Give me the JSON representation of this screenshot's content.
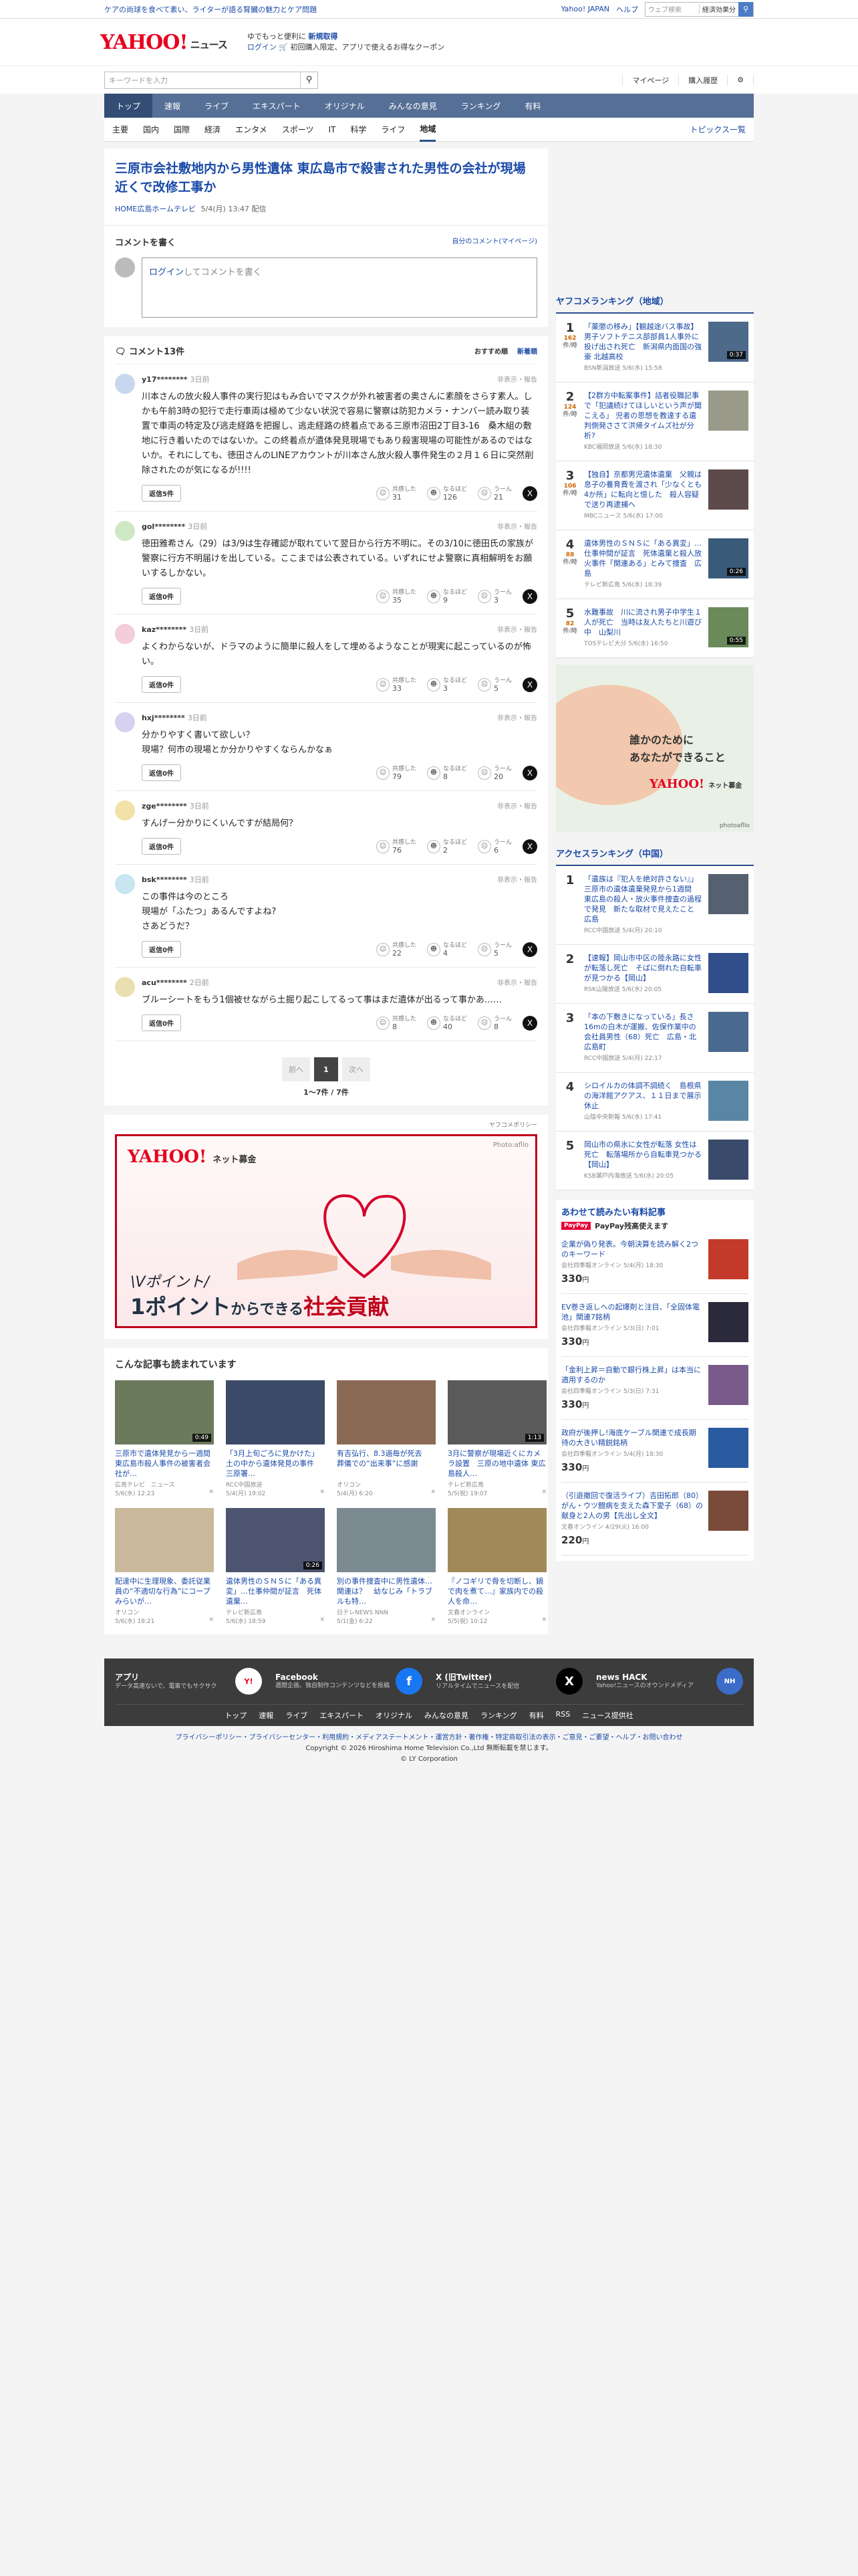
{
  "topstrip": {
    "promo": "ケアの尚球を食べて素い、ライターが語る腎臓の魅力とケア問題",
    "yjapan": "Yahoo! JAPAN",
    "help": "ヘルプ",
    "search_ph": "ウェブ検索",
    "search_hint": "経済効果分"
  },
  "header": {
    "logo": "YAHOO!",
    "logo_sub": "ニュース",
    "sub_japan": "JAPAN",
    "promo1a": "ゆでもっと便利に",
    "promo1b": "新規取得",
    "promo2a": "ログイン",
    "promo2b": "初回購入限定、アプリで使えるお得なクーポン"
  },
  "search": {
    "placeholder": "キーワードを入力",
    "mypage": "マイページ",
    "history": "購入履歴"
  },
  "nav": [
    {
      "label": "トップ"
    },
    {
      "label": "速報"
    },
    {
      "label": "ライブ"
    },
    {
      "label": "エキスパート"
    },
    {
      "label": "オリジナル"
    },
    {
      "label": "みんなの意見"
    },
    {
      "label": "ランキング"
    },
    {
      "label": "有料"
    }
  ],
  "subnav": [
    {
      "label": "主要"
    },
    {
      "label": "国内"
    },
    {
      "label": "国際"
    },
    {
      "label": "経済"
    },
    {
      "label": "エンタメ"
    },
    {
      "label": "スポーツ"
    },
    {
      "label": "IT"
    },
    {
      "label": "科学"
    },
    {
      "label": "ライフ"
    },
    {
      "label": "地域"
    }
  ],
  "subnav_ranking": "トピックス一覧",
  "article": {
    "title": "三原市会社敷地内から男性遺体 東広島市で殺害された男性の会社が現場近くで改修工事か",
    "source": "HOME広島ホームテレビ",
    "date": "5/4(月) 13:47 配信"
  },
  "write": {
    "heading": "コメントを書く",
    "mine": "自分のコメント(マイページ)",
    "login": "ログイン",
    "rest": "してコメントを書く"
  },
  "clist": {
    "heading": "コメント13件",
    "sort1": "おすすめ順",
    "sort2": "新着順",
    "react1": "共感した",
    "react2": "なるほど",
    "react3": "うーん",
    "report": "非表示・報告"
  },
  "comments": [
    {
      "user": "y17********",
      "time": "3日前",
      "text": "川本さんの放火殺人事件の実行犯はもみ合いでマスクが外れ被害者の奥さんに素顔をさらす素人。しかも午前3時の犯行で走行車両は極めて少ない状況で容易に警察は防犯カメラ・ナンバー読み取り装置で車両の特定及び逃走経路を把握し、逃走経路の終着点である三原市沼田2丁目3-16　桑木組の敷地に行き着いたのではないか。この終着点が遺体発見現場でもあり殺害現場の可能性があるのではないか。それにしても、徳田さんのLINEアカウントが川本さん放火殺人事件発生の２月１６日に突然削除されたのが気になるが!!!!",
      "reply": "返信5件",
      "r1": "31",
      "r2": "126",
      "r3": "21"
    },
    {
      "user": "gol********",
      "time": "3日前",
      "text": "徳田雅希さん（29）は3/9は生存確認が取れていて翌日から行方不明に。その3/10に徳田氏の家族が警察に行方不明届けを出している。ここまでは公表されている。いずれにせよ警察に真相解明をお願いするしかない。",
      "reply": "返信0件",
      "r1": "35",
      "r2": "9",
      "r3": "3"
    },
    {
      "user": "kaz********",
      "time": "3日前",
      "text": "よくわからないが、ドラマのように簡単に殺人をして埋めるようなことが現実に起こっているのが怖い。",
      "reply": "返信0件",
      "r1": "33",
      "r2": "3",
      "r3": "5"
    },
    {
      "user": "hxj********",
      "time": "3日前",
      "text": "分かりやすく書いて欲しい？\n現場？何市の現場とか分かりやすくならんかなぁ",
      "reply": "返信0件",
      "r1": "79",
      "r2": "8",
      "r3": "20"
    },
    {
      "user": "zge********",
      "time": "3日前",
      "text": "すんげー分かりにくいんですが結局何？",
      "reply": "返信0件",
      "r1": "76",
      "r2": "2",
      "r3": "6"
    },
    {
      "user": "bsk********",
      "time": "3日前",
      "text": "この事件は今のところ\n現場が「ふたつ」あるんですよね?\nさあどうだ？",
      "reply": "返信0件",
      "r1": "22",
      "r2": "4",
      "r3": "5"
    },
    {
      "user": "acu********",
      "time": "2日前",
      "text": "ブルーシートをもう1個被せながら土掘り起こしてるって事はまだ遺体が出るって事かあ……",
      "reply": "返信0件",
      "r1": "8",
      "r2": "40",
      "r3": "8"
    }
  ],
  "pager": {
    "prev": "前へ",
    "cur": "1",
    "next": "次へ",
    "count": "1〜7件 / 7件"
  },
  "ad": {
    "label": "ヤフコメポリシー",
    "brand": "YAHOO!",
    "brand_sub": "ネット募金",
    "photo": "Photo:afllo",
    "line1": "\\Vポイント/",
    "line2a": "1ポイント",
    "line2b": "からできる",
    "line2c": "社会貢献"
  },
  "also": {
    "heading": "こんな記事も読まれています",
    "items": [
      {
        "title": "三原市で遺体発見から一週間　東広島市殺人事件の被害者会社が…",
        "src": "広島テレビ　ニュース",
        "date": "5/6(水) 12:23",
        "dur": "0:49"
      },
      {
        "title": "「3月上旬ごろに見かけた」土の中から遺体発見の事件　三原署…",
        "src": "RCC中国放送",
        "date": "5/4(月) 19:02",
        "dur": ""
      },
      {
        "title": "有吉弘行、8.3過毎が死去　葬儀での“出来事”に感謝",
        "src": "オリコン",
        "date": "5/4(月) 6:20",
        "dur": ""
      },
      {
        "title": "3月に警察が現場近くにカメラ設置　三原の地中遺体 東広島殺人…",
        "src": "テレビ新広島",
        "date": "5/5(祝) 19:07",
        "dur": "1:13"
      },
      {
        "title": "配達中に生理現象、委託従業員の“不適切な行為”にコープみらいが…",
        "src": "オリコン",
        "date": "5/6(水) 18:21",
        "dur": ""
      },
      {
        "title": "遺体男性のＳＮＳに「ある異変」…仕事仲間が証言　死体遺棄…",
        "src": "テレビ新広島",
        "date": "5/6(水) 18:59",
        "dur": "0:26"
      },
      {
        "title": "別の事件捜査中に男性遺体…関連は？　幼なじみ「トラブルも特…",
        "src": "日テレNEWS NNN",
        "date": "5/1(金) 6:22",
        "dur": ""
      },
      {
        "title": "『ノコギリで骨を切断し、鍋で肉を煮て…』家族内での殺人を命…",
        "src": "文春オンライン",
        "date": "5/5(祝) 10:12",
        "dur": ""
      }
    ]
  },
  "side": {
    "heading1": "ヤフコメランキング（地域）",
    "unit": "件/時",
    "rank1": [
      {
        "n": "1",
        "cnt": "162",
        "t": "「薬懲の移み」【観越途バス事故】男子ソフトテニス部部員1人事外に投げ出され死亡　新潟県内面国の強豪 北越高校",
        "s": "BSN新潟放送 5/6(水) 15:58",
        "dur": "0:37"
      },
      {
        "n": "2",
        "cnt": "124",
        "t": "【2群方中転案事件】詰者役職記事で「犯議続けてほしいという声が聞こえる」 児者の思想を教達する遺判側発ささて洪帰タイムズ社が分析?",
        "s": "KBC福岡放送 5/6(水) 18:30",
        "dur": ""
      },
      {
        "n": "3",
        "cnt": "106",
        "t": "【独自】京都男児遺体遺棄　父親は息子の養育費を渡され「少なくとも4か所」に転向と憶した　殺人容疑で送り再逮捕へ",
        "s": "MBCニュース 5/6(水) 17:00",
        "dur": ""
      },
      {
        "n": "4",
        "cnt": "88",
        "t": "遺体男性のＳＮＳに「ある異変」…仕事仲間が証言　死体遺棄と殺人放火事件「関連ある」とみて捜査　広島",
        "s": "テレビ新広島 5/6(水) 18:39",
        "dur": "0:26"
      },
      {
        "n": "5",
        "cnt": "82",
        "t": "水難事故　川に流され男子中学生１人が死亡　当時は友人たちと川遊び中　山梨川",
        "s": "TOSテレビ大分 5/6(水) 16:50",
        "dur": "0:55"
      }
    ],
    "ad_t1": "誰かのために",
    "ad_t2": "あなたができること",
    "ad_brand": "YAHOO!",
    "ad_brand_sub": "ネット募金",
    "ad_photo": "photoafllo",
    "heading2": "アクセスランキング（中国）",
    "rank2": [
      {
        "n": "1",
        "t": "「遺族は『犯人を絶対許さない』」三原市の遺体遺棄発見から1週間　東広島の殺人・放火事件捜査の過程で発見　新たな取材で見えたこと　広島",
        "s": "RCC中国放送 5/4(月) 20:10"
      },
      {
        "n": "2",
        "t": "【速報】岡山市中区の陸永路に女性が転落し死亡　そばに倒れた自転車が見つかる【岡山】",
        "s": "RSK山陽放送 5/6(水) 20:05"
      },
      {
        "n": "3",
        "t": "「本の下敷きになっている」長さ16mの白木が運搬、佐保作業中の会社員男性（68）死亡　広島・北広島町",
        "s": "RCC中国放送 5/4(月) 22:17"
      },
      {
        "n": "4",
        "t": "シロイルカの体調不調続く　島根県の海洋館アクアス、１１日まで展示休止",
        "s": "山陰中央新報 5/6(水) 17:41"
      },
      {
        "n": "5",
        "t": "岡山市の県氷に女性が転落 女性は死亡　転落場所から自転車見つかる【岡山】",
        "s": "KSB瀬戸内海放送 5/6(水) 20:05"
      }
    ],
    "paid_heading": "あわせて読みたい有料記事",
    "paid_sub": "PayPay残高使えます",
    "pay_label": "PayPay",
    "paid": [
      {
        "t": "企業が偽り発表。今朝決算を読み解く2つのキーワード",
        "s": "会社四季報オンライン 5/4(月) 18:30",
        "p": "330",
        "u": "円"
      },
      {
        "t": "EV巻き返しへの起爆剤と注目、「全固体電池」関連7銘柄",
        "s": "会社四季報オンライン 5/3(日) 7:01",
        "p": "330",
        "u": "円"
      },
      {
        "t": "「金利上昇＝自動で銀行株上昇」は本当に適用するのか",
        "s": "会社四季報オンライン 5/3(日) 7:31",
        "p": "330",
        "u": "円"
      },
      {
        "t": "政府が後押し!海底ケーブル関連で成長期待の大きい精鋭銘柄",
        "s": "会社四季報オンライン 5/4(月) 18:30",
        "p": "330",
        "u": "円"
      },
      {
        "t": "（引退撤回で復活ライブ）吉田拓郎（80）がん・ウツ闘病を支えた森下愛子（68）の献身と2人の男【先出し全文】",
        "s": "文春オンライン 4/29(火) 16:00",
        "p": "220",
        "u": "円"
      }
    ]
  },
  "footer": {
    "apps": [
      {
        "h": "アプリ",
        "p": "データ高速ないで、電車でもサクサク"
      },
      {
        "h": "Facebook",
        "p": "週間企画、独自制作コンテンツなどを投稿"
      },
      {
        "h": "X (旧Twitter)",
        "p": "リアルタイムでニュースを配信"
      },
      {
        "h": "news HACK",
        "p": "Yahoo!ニュースのオウンドメディア"
      }
    ],
    "links": [
      {
        "l": "トップ"
      },
      {
        "l": "速報"
      },
      {
        "l": "ライブ"
      },
      {
        "l": "エキスパート"
      },
      {
        "l": "オリジナル"
      },
      {
        "l": "みんなの意見"
      },
      {
        "l": "ランキング"
      },
      {
        "l": "有料"
      },
      {
        "l": "RSS"
      },
      {
        "l": "ニュース提供社"
      }
    ],
    "policy": "プライバシーポリシー・プライバシーセンター・利用規約・メディアステートメント・運営方針・著作権・特定商取引法の表示・ご意見・ご要望・ヘルプ・お問い合わせ",
    "copy": "Copyright © 2026 Hiroshima Home Television Co.,Ltd 無断転載を禁じます。",
    "ly": "© LY Corporation"
  }
}
